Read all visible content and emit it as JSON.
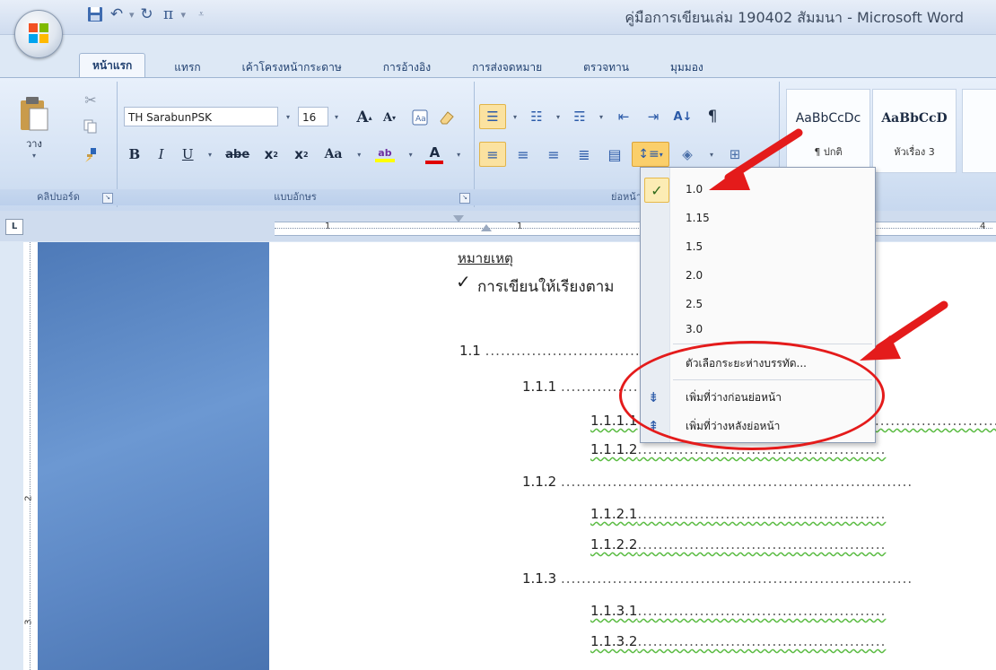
{
  "window": {
    "title": "คู่มือการเขียนเล่ม 190402 สัมมนา - Microsoft Word"
  },
  "quick_access": {
    "save_icon": "save-icon",
    "undo_icon": "undo-icon",
    "redo_icon": "redo-icon",
    "pi_label": "π",
    "customize_icon": "customize-icon"
  },
  "tabs": [
    "หน้าแรก",
    "แทรก",
    "เค้าโครงหน้ากระดาษ",
    "การอ้างอิง",
    "การส่งจดหมาย",
    "ตรวจทาน",
    "มุมมอง"
  ],
  "clipboard": {
    "paste_label": "วาง",
    "group_label": "คลิปบอร์ด"
  },
  "font": {
    "name": "TH SarabunPSK",
    "size": "16",
    "group_label": "แบบอักษร",
    "strike_label": "abe",
    "case_label": "Aa",
    "highlight_color": "#ffff00",
    "font_color": "#e00000"
  },
  "paragraph": {
    "group_label": "ย่อหน้า"
  },
  "styles": [
    {
      "sample": "AaBbCcDc",
      "name": "¶ ปกติ"
    },
    {
      "sample": "AaBbCcD",
      "name": "หัวเรื่อง 3"
    }
  ],
  "ruler": {
    "v_mark_2": "2",
    "v_mark_3": "3",
    "h_mark_1": "1",
    "h_mark_1b": "1",
    "h_mark_4": "4",
    "corner": "L"
  },
  "document": {
    "note_heading": "หมายเหตุ",
    "checkmark": "✓",
    "bullet_text": "การเขียนให้เรียงตาม",
    "lines": [
      {
        "num": "1.1",
        "dots": "......................................................",
        "level": 0
      },
      {
        "num": "1.1.1",
        "dots": ".......................",
        "level": 1
      },
      {
        "num": "1.1.1.1",
        "dots": "",
        "level": 2,
        "squiggle": true
      },
      {
        "num": "1.1.1.2",
        "dots": "................................................",
        "level": 2,
        "squiggle": true
      },
      {
        "num": "1.1.2",
        "dots": "....................................................................",
        "level": 1
      },
      {
        "num": "1.1.2.1",
        "dots": "................................................",
        "level": 2,
        "squiggle": true
      },
      {
        "num": "1.1.2.2",
        "dots": "................................................",
        "level": 2,
        "squiggle": true
      },
      {
        "num": "1.1.3",
        "dots": "....................................................................",
        "level": 1
      },
      {
        "num": "1.1.3.1",
        "dots": "................................................",
        "level": 2,
        "squiggle": true
      },
      {
        "num": "1.1.3.2",
        "dots": "................................................",
        "level": 2,
        "squiggle": true
      }
    ],
    "extra_dots": "........................"
  },
  "line_spacing_menu": {
    "items": [
      "1.0",
      "1.15",
      "1.5",
      "2.0",
      "2.5",
      "3.0"
    ],
    "checked": "1.0",
    "check_glyph": "✓",
    "options_label": "ตัวเลือกระยะห่างบรรทัด...",
    "add_before_label": "เพิ่มที่ว่างก่อนย่อหน้า",
    "add_after_label": "เพิ่มที่ว่างหลังย่อหน้า"
  },
  "colors": {
    "accent": "#e41b1b",
    "ribbon": "#d3e1f3",
    "workspace": "#5d88c5"
  }
}
